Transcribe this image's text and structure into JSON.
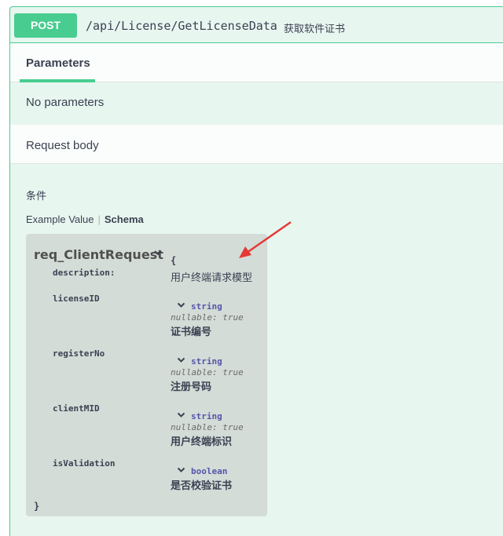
{
  "endpoint": {
    "method": "POST",
    "path": "/api/License/GetLicenseData",
    "description": "获取软件证书",
    "method_color": "#49cc90"
  },
  "parameters": {
    "tab_label": "Parameters",
    "empty_text": "No parameters"
  },
  "request_body": {
    "title": "Request body",
    "condition_label": "条件",
    "tabs": [
      "Example Value",
      "Schema"
    ],
    "active_tab": "Schema"
  },
  "model": {
    "name": "req_ClientRequest",
    "open_brace": "{",
    "close_brace": "}",
    "description_key": "description:",
    "description_value": "用户终端请求模型",
    "properties": [
      {
        "name": "licenseID",
        "type": "string",
        "nullable": "nullable: true",
        "description": "证书编号"
      },
      {
        "name": "registerNo",
        "type": "string",
        "nullable": "nullable: true",
        "description": "注册号码"
      },
      {
        "name": "clientMID",
        "type": "string",
        "nullable": "nullable: true",
        "description": "用户终端标识"
      },
      {
        "name": "isValidation",
        "type": "boolean",
        "description": "是否校验证书"
      }
    ]
  },
  "icons": {
    "model_toggle": "chevron-down-icon",
    "annotation": "red-arrow-icon"
  }
}
